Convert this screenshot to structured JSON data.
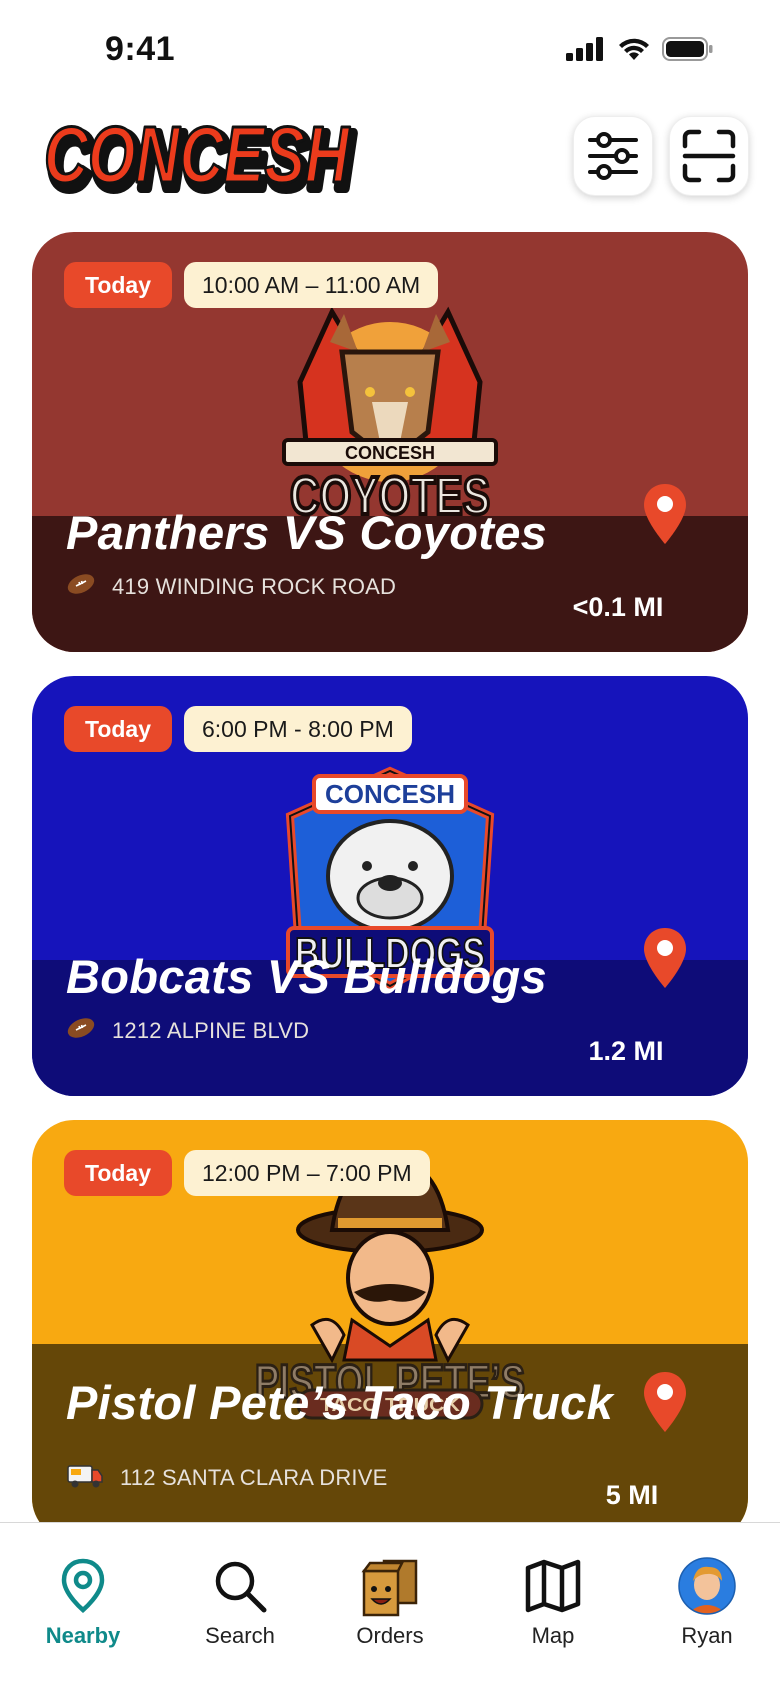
{
  "status_bar": {
    "time": "9:41"
  },
  "app": {
    "brand": "CONCESH",
    "brand_color": "#e8401f"
  },
  "header": {
    "filter_icon": "sliders-icon",
    "scan_icon": "scan-icon"
  },
  "cards": [
    {
      "badge": "Today",
      "time": "10:00 AM – 11:00 AM",
      "title": "Panthers VS Coyotes",
      "address": "419 WINDING ROCK ROAD",
      "address_icon": "football-icon",
      "distance": "<0.1 MI",
      "logo_top": "CONCESH",
      "logo_bottom": "COYOTES",
      "bg_color": "#943730",
      "band_color": "#3d1614"
    },
    {
      "badge": "Today",
      "time": "6:00 PM - 8:00 PM",
      "title": "Bobcats VS Bulldogs",
      "address": "1212 ALPINE BLVD",
      "address_icon": "football-icon",
      "distance": "1.2 MI",
      "logo_top": "CONCESH",
      "logo_bottom": "BULLDOGS",
      "bg_color": "#1614bb",
      "band_color": "#0e0c78"
    },
    {
      "badge": "Today",
      "time": "12:00 PM – 7:00 PM",
      "title": "Pistol Pete’s Taco Truck",
      "address": "112 SANTA CLARA DRIVE",
      "address_icon": "food-truck-icon",
      "distance": "5 MI",
      "logo_top": "PISTOL PETE’S",
      "logo_bottom": "TACO TRUCK",
      "bg_color": "#f8a911",
      "band_color": "#654708"
    }
  ],
  "tabs": [
    {
      "label": "Nearby",
      "icon": "location-pin-icon",
      "active": true
    },
    {
      "label": "Search",
      "icon": "search-icon",
      "active": false
    },
    {
      "label": "Orders",
      "icon": "orders-bag-icon",
      "active": false
    },
    {
      "label": "Map",
      "icon": "map-icon",
      "active": false
    },
    {
      "label": "Ryan",
      "icon": "avatar",
      "active": false
    }
  ],
  "colors": {
    "accent": "#0f8a8a",
    "pin": "#e8492a",
    "today_badge": "#e8492a",
    "time_pill": "#fdf1d2"
  }
}
